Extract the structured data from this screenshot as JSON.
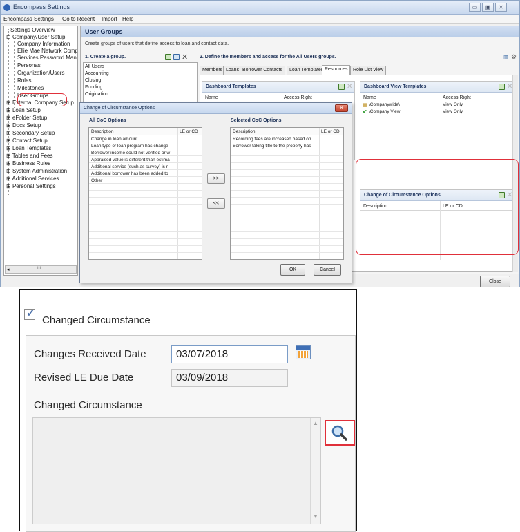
{
  "window": {
    "title": "Encompass Settings",
    "controls": [
      "▭",
      "▣",
      "✕"
    ]
  },
  "menu": [
    "Encompass Settings",
    "Go to Recent",
    "Import",
    "Help"
  ],
  "tree": {
    "items": [
      "Settings Overview",
      "Company/User Setup",
      "Company Information",
      "Ellie Mae Network Company",
      "Services Password Manager",
      "Personas",
      "Organization/Users",
      "Roles",
      "Milestones",
      "User Groups",
      "External Company Setup",
      "Loan Setup",
      "eFolder Setup",
      "Docs Setup",
      "Secondary Setup",
      "Contact Setup",
      "Loan Templates",
      "Tables and Fees",
      "Business Rules",
      "System Administration",
      "Additional Services",
      "Personal Settings"
    ],
    "scroll_mark": "III"
  },
  "main": {
    "title": "User Groups",
    "subtitle": "Create groups of users that define access to loan and contact data.",
    "step1": "1. Create a group.",
    "groups": [
      "All Users",
      "Accounting",
      "Closing",
      "Funding",
      "Origination"
    ],
    "step2": "2. Define the members and access for the All Users groups.",
    "tabs": [
      "Members",
      "Loans",
      "Borrower Contacts",
      "Loan Templates",
      "Resources",
      "Role List View"
    ],
    "dashboard_templates": {
      "title": "Dashboard Templates",
      "col_name": "Name",
      "col_access": "Access Right"
    },
    "dashboard_view_templates": {
      "title": "Dashboard View Templates",
      "col_name": "Name",
      "col_access": "Access Right",
      "rows": [
        {
          "name": "\\Companywide\\",
          "access": "View Only"
        },
        {
          "name": "\\Company View",
          "access": "View Only"
        }
      ]
    },
    "coc_panel": {
      "title": "Change of Circumstance Options",
      "col_desc": "Description",
      "col_lecd": "LE or CD"
    },
    "close_button": "Close"
  },
  "dialog": {
    "title": "Change of Circumstance Options",
    "close_glyph": "✕",
    "all_title": "All CoC Options",
    "selected_title": "Selected CoC Options",
    "col_desc": "Description",
    "col_lecd": "LE or CD",
    "all_options": [
      "Change in loan amount",
      "Loan type or loan program has change",
      "Borrower income could not verified or w",
      "Appraised value is different than estima",
      "Additional service (such as survey) is n",
      "Additional borrower has been added to",
      "Other"
    ],
    "selected_options": [
      "Recording fees are increased based on",
      "Borrower taking title to the property has"
    ],
    "add_button": ">>",
    "remove_button": "<<",
    "ok": "OK",
    "cancel": "Cancel"
  },
  "form": {
    "checkbox_label": "Changed Circumstance",
    "changes_received_label": "Changes Received Date",
    "changes_received_value": "03/07/2018",
    "revised_le_label": "Revised LE Due Date",
    "revised_le_value": "03/09/2018",
    "changed_circumstance_label": "Changed Circumstance",
    "scroll_up": "▲",
    "scroll_down": "▼"
  },
  "colors": {
    "highlight_red": "#e0303a",
    "header_blue": "#c6d7ee",
    "check_green": "#2e9a2e"
  }
}
